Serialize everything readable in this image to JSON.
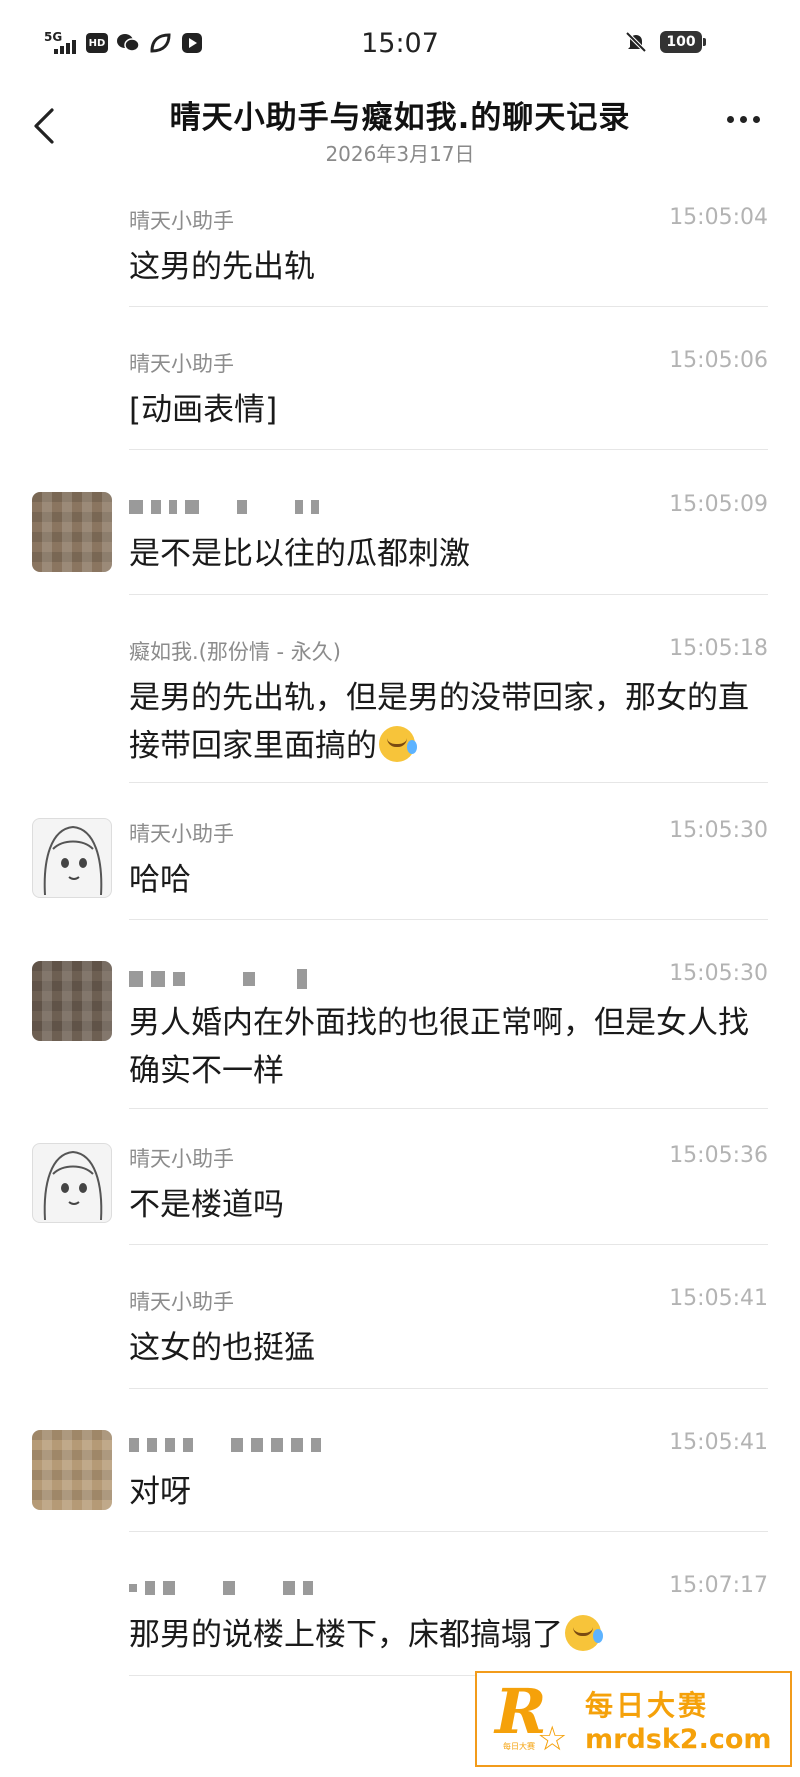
{
  "status_bar": {
    "network": "5G",
    "hd": "HD",
    "time": "15:07",
    "battery": "100"
  },
  "header": {
    "title": "晴天小助手与癡如我.的聊天记录",
    "date": "2026年3月17日"
  },
  "messages": [
    {
      "sender": "晴天小助手",
      "time": "15:05:04",
      "text": "这男的先出轨",
      "avatar": "none",
      "censored": false
    },
    {
      "sender": "晴天小助手",
      "time": "15:05:06",
      "text": "[动画表情]",
      "avatar": "none",
      "censored": false
    },
    {
      "sender": "",
      "time": "15:05:09",
      "text": "是不是比以往的瓜都刺激",
      "avatar": "blurred-avatar",
      "censored": true
    },
    {
      "sender": "癡如我.(那份情 - 永久)",
      "time": "15:05:18",
      "text": "是男的先出轨，但是男的没带回家，那女的直接带回家里面搞的",
      "avatar": "none",
      "censored": false,
      "emoji": "laughing-crying-emoji"
    },
    {
      "sender": "晴天小助手",
      "time": "15:05:30",
      "text": "哈哈",
      "avatar": "anime-avatar",
      "censored": false
    },
    {
      "sender": "",
      "time": "15:05:30",
      "text": "男人婚内在外面找的也很正常啊，但是女人找确实不一样",
      "avatar": "blurred-avatar",
      "censored": true
    },
    {
      "sender": "晴天小助手",
      "time": "15:05:36",
      "text": "不是楼道吗",
      "avatar": "anime-avatar",
      "censored": false
    },
    {
      "sender": "晴天小助手",
      "time": "15:05:41",
      "text": "这女的也挺猛",
      "avatar": "none",
      "censored": false
    },
    {
      "sender": "",
      "time": "15:05:41",
      "text": "对呀",
      "avatar": "cat-avatar",
      "censored": true
    },
    {
      "sender": "",
      "time": "15:07:17",
      "text": "那男的说楼上楼下，床都搞塌了",
      "avatar": "none",
      "censored": true,
      "emoji": "laughing-crying-emoji"
    }
  ],
  "watermark": {
    "logo_letter": "R",
    "logo_small": "每日大赛",
    "name": "每日大赛",
    "url": "mrdsk2.com"
  },
  "colors": {
    "accent": "#f5a10a",
    "text": "#1a1a1a",
    "meta": "#8c8c8c",
    "time": "#b3b3b3"
  }
}
